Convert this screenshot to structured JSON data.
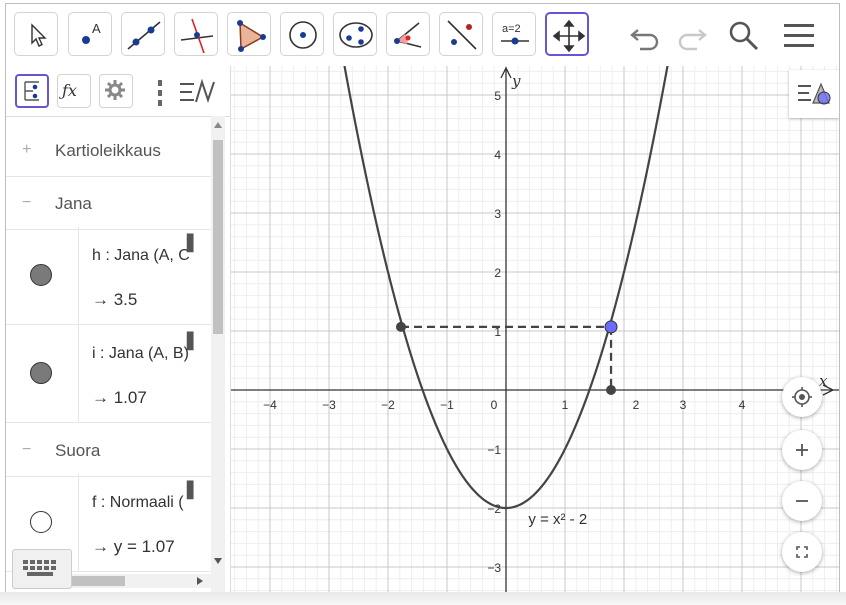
{
  "toolbar": {
    "tools": [
      {
        "name": "move"
      },
      {
        "name": "point",
        "letter": "A"
      },
      {
        "name": "line"
      },
      {
        "name": "perpendicular-line"
      },
      {
        "name": "polygon"
      },
      {
        "name": "circle-center-point"
      },
      {
        "name": "ellipse"
      },
      {
        "name": "angle"
      },
      {
        "name": "reflect-about-line"
      },
      {
        "name": "slider",
        "text": "a=2"
      },
      {
        "name": "move-graphics-view"
      }
    ],
    "active_tool": "move-graphics-view"
  },
  "algebra": {
    "groups": [
      {
        "label": "Kartioleikkaus",
        "expanded": false
      },
      {
        "label": "Jana",
        "expanded": true
      },
      {
        "label": "Suora",
        "expanded": true
      }
    ],
    "items": [
      {
        "definition": "h : Jana (A, C",
        "value": "→  3.5",
        "color": "#7a7a7a",
        "filled": true
      },
      {
        "definition": "i : Jana (A, B)",
        "value": "→  1.07",
        "color": "#7a7a7a",
        "filled": true
      },
      {
        "definition": "f : Normaali (",
        "value": "→  y = 1.07",
        "color": "#ffffff",
        "filled": false
      }
    ]
  },
  "graph": {
    "x_ticks": [
      "−4",
      "−3",
      "−2",
      "−1",
      "0",
      "1",
      "2",
      "3",
      "4"
    ],
    "y_ticks": [
      "5",
      "4",
      "3",
      "2",
      "1",
      "−1",
      "−2",
      "−3"
    ],
    "x_axis_label": "x",
    "y_axis_label": "y",
    "function_label": "y = x² - 2",
    "curve_color": "#444444",
    "point_color": "#6b6bff"
  },
  "chart_data": {
    "type": "line",
    "series": [
      {
        "name": "y = x² - 2",
        "formula": "x^2 - 2"
      }
    ],
    "points": [
      {
        "x": -1.78,
        "y": 1.07
      },
      {
        "x": 1.78,
        "y": 1.07
      },
      {
        "x": 1.78,
        "y": 0
      }
    ],
    "xlim": [
      -4.6,
      5.75
    ],
    "ylim": [
      -3.55,
      5.5
    ],
    "grid": true
  }
}
